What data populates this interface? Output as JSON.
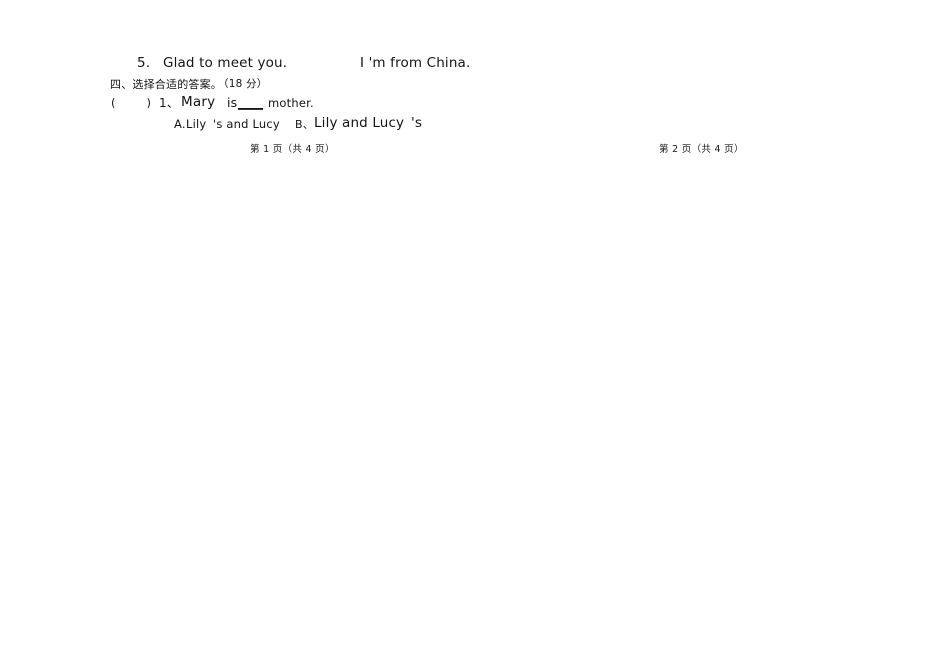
{
  "document": {
    "type": "scanned-exam-paper",
    "background_color": "#ffffff",
    "text_color": "#141414"
  },
  "question_5": {
    "number": "5.",
    "prompt": "Glad to meet you.",
    "answer": "I 'm from China."
  },
  "section_four": {
    "heading": "四、选择合适的答案。",
    "score": "（18 分）"
  },
  "question_1": {
    "bracket": "(        )",
    "index": "1、",
    "stem_part_1": "Mary",
    "stem_part_2": "is",
    "blank": "____",
    "stem_part_3": "mother.",
    "options": [
      {
        "label": "A.",
        "text": "Lily",
        "tail": "'s and Lucy"
      },
      {
        "label": "B、",
        "text": "Lily and Lucy",
        "tail": "'s"
      }
    ]
  },
  "footers": {
    "left": "第 1 页（共 4 页）",
    "right": "第 2 页（共 4 页）"
  }
}
